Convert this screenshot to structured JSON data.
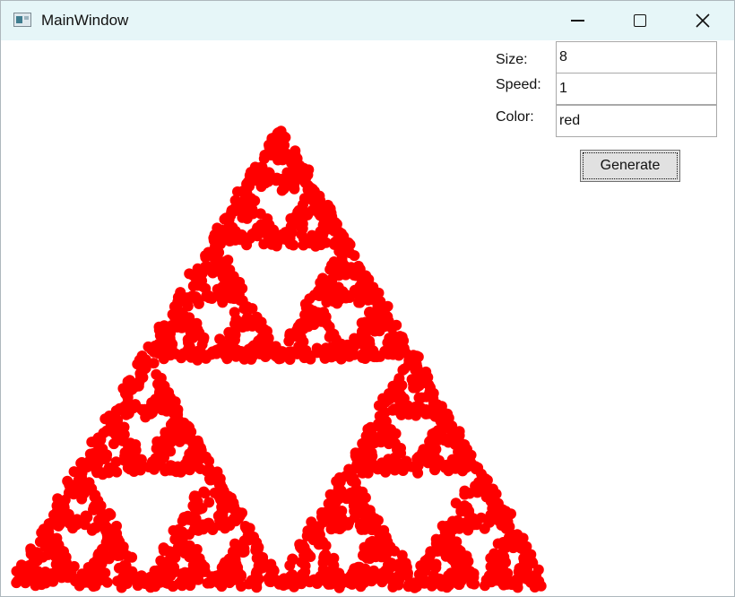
{
  "window": {
    "title": "MainWindow",
    "icon": "app-window-icon"
  },
  "caption_buttons": {
    "minimize": "minimize-icon",
    "maximize": "maximize-icon",
    "close": "close-icon"
  },
  "form": {
    "size_label": "Size:",
    "size_value": "8",
    "speed_label": "Speed:",
    "speed_value": "1",
    "color_label": "Color:",
    "color_value": "red",
    "generate_label": "Generate"
  },
  "fractal": {
    "type": "sierpinski-chaos-game",
    "dot_size": 8,
    "color": "#ff0000"
  },
  "colors": {
    "titlebar": "#e6f6f8",
    "button": "#e1e1e1",
    "dot": "#ff0000"
  }
}
